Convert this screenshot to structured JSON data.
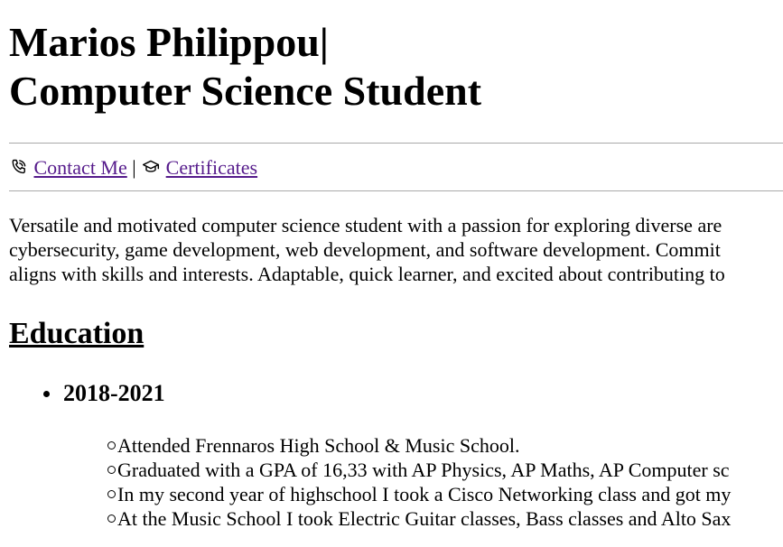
{
  "header": {
    "title_line1": "Marios Philippou|",
    "title_line2": "Computer Science Student"
  },
  "nav": {
    "contact_icon": "phone-icon",
    "contact_label": "Contact Me",
    "separator": "|",
    "certificates_icon": "graduation-cap-icon",
    "certificates_label": "Certificates",
    "link_color": "#551a8b"
  },
  "summary": {
    "lines": [
      "Versatile and motivated computer science student with a passion for exploring diverse are",
      "cybersecurity, game development, web development, and software development. Commit",
      "aligns with skills and interests. Adaptable, quick learner, and excited about contributing to"
    ]
  },
  "education": {
    "heading": "Education",
    "entries": [
      {
        "period": "2018-2021",
        "details": [
          "Attended Frennaros High School & Music School.",
          "Graduated with a GPA of 16,33 with AP Physics, AP Maths, AP Computer sc",
          "In my second year of highschool I took a Cisco Networking class and got my",
          "At the Music School I took Electric Guitar classes, Bass classes and Alto Sax"
        ]
      }
    ]
  }
}
